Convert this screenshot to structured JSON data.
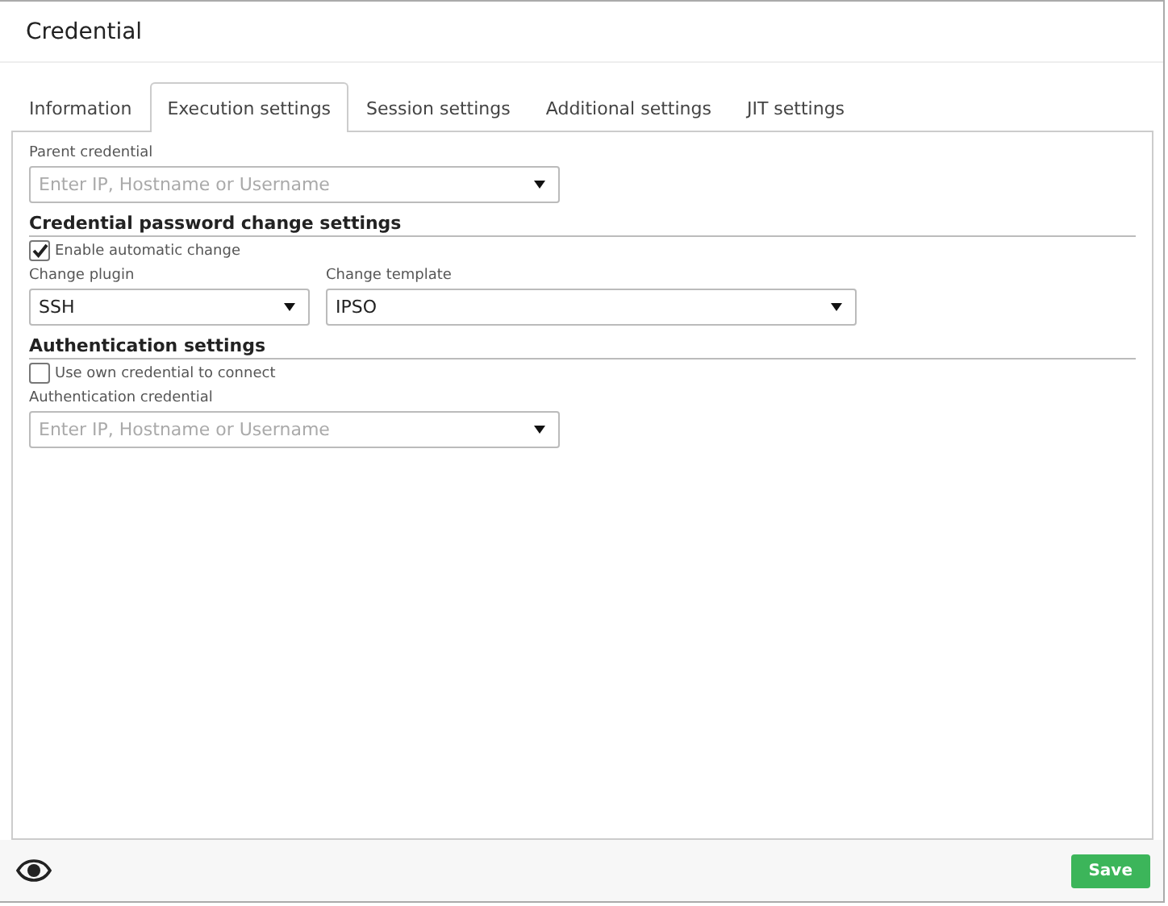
{
  "window": {
    "title": "Credential"
  },
  "tabs": [
    {
      "label": "Information",
      "selected": false
    },
    {
      "label": "Execution settings",
      "selected": true
    },
    {
      "label": "Session settings",
      "selected": false
    },
    {
      "label": "Additional settings",
      "selected": false
    },
    {
      "label": "JIT settings",
      "selected": false
    }
  ],
  "parent_credential": {
    "label": "Parent credential",
    "placeholder": "Enter IP, Hostname or Username"
  },
  "password_change": {
    "heading": "Credential password change settings",
    "checkbox": {
      "label": "Enable automatic change",
      "checked": true
    },
    "plugin": {
      "label": "Change plugin",
      "value": "SSH"
    },
    "template": {
      "label": "Change template",
      "value": "IPSO"
    }
  },
  "authentication": {
    "heading": "Authentication settings",
    "checkbox": {
      "label": "Use own credential to connect",
      "checked": false
    },
    "credential": {
      "label": "Authentication credential",
      "placeholder": "Enter IP, Hostname or Username"
    }
  },
  "footer": {
    "save_button": "Save"
  }
}
